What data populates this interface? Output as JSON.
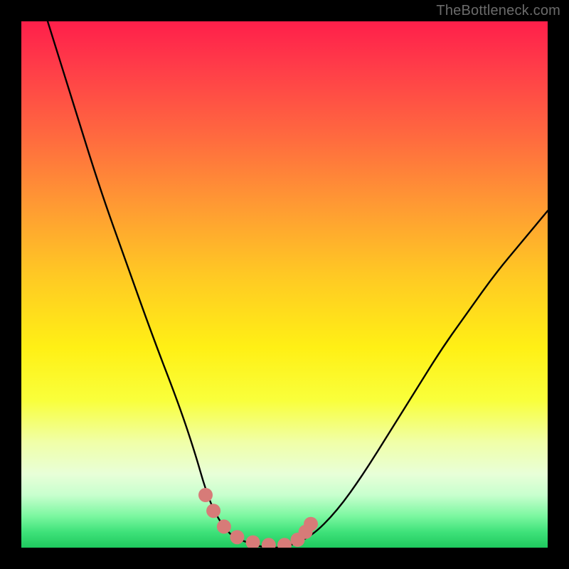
{
  "watermark": {
    "text": "TheBottleneck.com"
  },
  "colors": {
    "frame": "#000000",
    "curve_stroke": "#000000",
    "marker_fill": "#d77b78",
    "gradient_top": "#ff1f4a",
    "gradient_bottom": "#1fc95e"
  },
  "chart_data": {
    "type": "line",
    "title": "",
    "xlabel": "",
    "ylabel": "",
    "xlim": [
      0,
      100
    ],
    "ylim": [
      0,
      100
    ],
    "grid": false,
    "legend": false,
    "series": [
      {
        "name": "bottleneck-curve",
        "x": [
          5,
          10,
          15,
          20,
          25,
          30,
          33,
          35,
          37,
          40,
          43,
          46,
          50,
          55,
          60,
          65,
          70,
          75,
          80,
          85,
          90,
          95,
          100
        ],
        "y": [
          100,
          84,
          68,
          54,
          40,
          27,
          18,
          11,
          6,
          2,
          1,
          0,
          0,
          2,
          7,
          14,
          22,
          30,
          38,
          45,
          52,
          58,
          64
        ]
      }
    ],
    "markers": [
      {
        "x": 35.0,
        "y": 10.0
      },
      {
        "x": 36.5,
        "y": 7.0
      },
      {
        "x": 38.5,
        "y": 4.0
      },
      {
        "x": 41.0,
        "y": 2.0
      },
      {
        "x": 44.0,
        "y": 1.0
      },
      {
        "x": 47.0,
        "y": 0.5
      },
      {
        "x": 50.0,
        "y": 0.5
      },
      {
        "x": 52.5,
        "y": 1.5
      },
      {
        "x": 54.0,
        "y": 3.0
      },
      {
        "x": 55.0,
        "y": 4.5
      }
    ]
  }
}
